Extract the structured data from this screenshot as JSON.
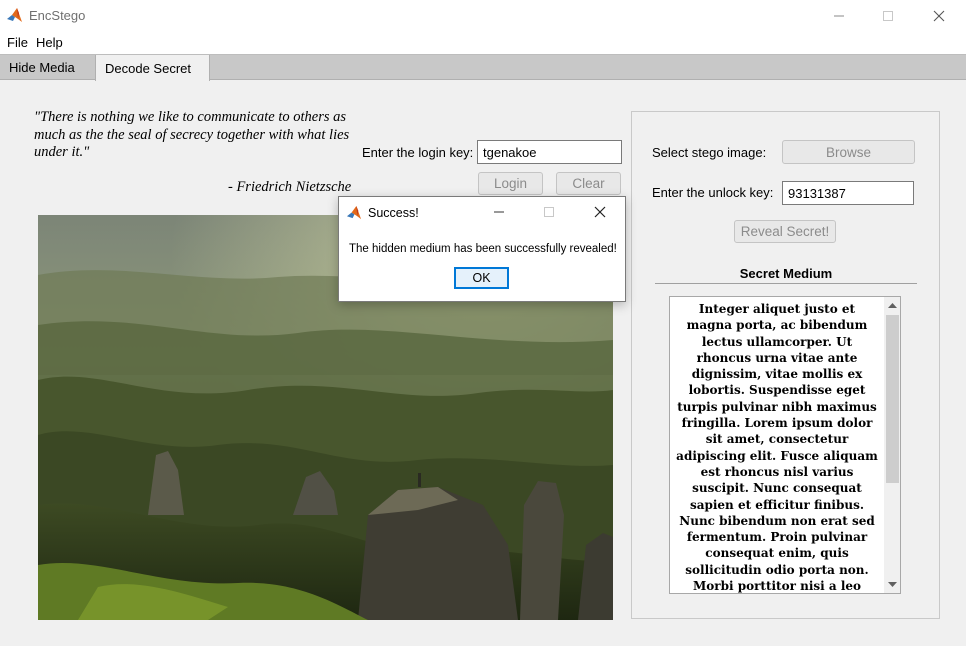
{
  "window": {
    "title": "EncStego",
    "controls": [
      "minimize-icon",
      "maximize-icon",
      "close-icon"
    ]
  },
  "menu": {
    "items": [
      "File",
      "Help"
    ]
  },
  "tabs": [
    {
      "label": "Hide Media",
      "active": false
    },
    {
      "label": "Decode Secret",
      "active": true
    }
  ],
  "quote": {
    "text": "\"There is nothing we like to communicate to others as much as the the seal of secrecy together with what lies under it.\"",
    "author": "- Friedrich Nietzsche"
  },
  "login": {
    "label": "Enter the login key:",
    "value": "tgenakoe",
    "login_button": "Login",
    "clear_button": "Clear"
  },
  "decode": {
    "select_label": "Select stego image:",
    "browse_button": "Browse",
    "unlock_label": "Enter the unlock key:",
    "unlock_value": "93131387",
    "reveal_button": "Reveal Secret!",
    "secret_title": "Secret Medium",
    "secret_text": "Integer aliquet justo et magna porta, ac bibendum lectus ullamcorper. Ut rhoncus urna vitae ante dignissim, vitae mollis ex lobortis. Suspendisse eget turpis pulvinar nibh maximus fringilla. Lorem ipsum dolor sit amet, consectetur adipiscing elit. Fusce aliquam est rhoncus nisl varius suscipit. Nunc consequat sapien et efficitur finibus. Nunc bibendum non erat sed fermentum. Proin pulvinar consequat enim, quis sollicitudin odio porta non. Morbi porttitor nisi a leo pharetra finibus. Fusce ac leo"
  },
  "dialog": {
    "title": "Success!",
    "message": "The hidden medium has been successfully revealed!",
    "ok_button": "OK"
  },
  "colors": {
    "accent": "#0078d7",
    "background": "#f0f0f0",
    "tabstrip": "#c8c8c8"
  }
}
